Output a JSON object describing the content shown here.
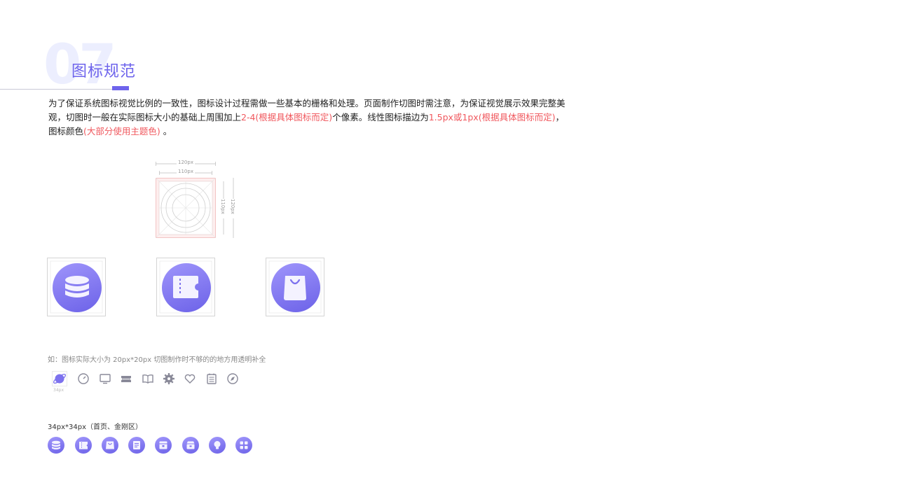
{
  "header": {
    "number": "07",
    "title": "图标规范"
  },
  "description": {
    "part1": "为了保证系统图标视觉比例的一致性，图标设计过程需做一些基本的栅格和处理。页面制作切图时需注意，为保证视觉展示效果完整美观，切图时一般在实际图标大小的基础上周围加上",
    "hl1": "2-4(根据具体图标而定)",
    "part2": "个像素。线性图标描边为",
    "hl2": "1.5px或1px(根据具体图标而定)",
    "part3": "，图标颜色",
    "hl3": "(大部分使用主题色)",
    "part4": " 。"
  },
  "spec_diagram": {
    "outer_label": "120px",
    "inner_label": "110px",
    "inner_v_label": "110px",
    "outer_v_label": "120px"
  },
  "large_icons": [
    {
      "icon": "database-icon"
    },
    {
      "icon": "ticket-icon"
    },
    {
      "icon": "shopping-bag-icon"
    }
  ],
  "line_icons_section": {
    "caption": "如：图标实际大小为 20px*20px 切图制作时不够的的地方用透明补全",
    "size_label": "34px",
    "icons": [
      "planet-icon",
      "speed-icon",
      "monitor-icon",
      "ticket-icon",
      "book-icon",
      "gear-icon",
      "heart-icon",
      "notepad-icon",
      "compass-icon"
    ]
  },
  "small_icons_section": {
    "caption": "34px*34px（首页、金刚区）",
    "icons": [
      "database-icon",
      "ticket-icon",
      "bag-icon",
      "document-icon",
      "box-icon",
      "archive-icon",
      "bulb-icon",
      "apps-icon"
    ]
  },
  "colors": {
    "accent": "#6e64ec",
    "highlight": "#f0585e",
    "gradient_start": "#9f95fb",
    "gradient_end": "#6c62e8"
  }
}
